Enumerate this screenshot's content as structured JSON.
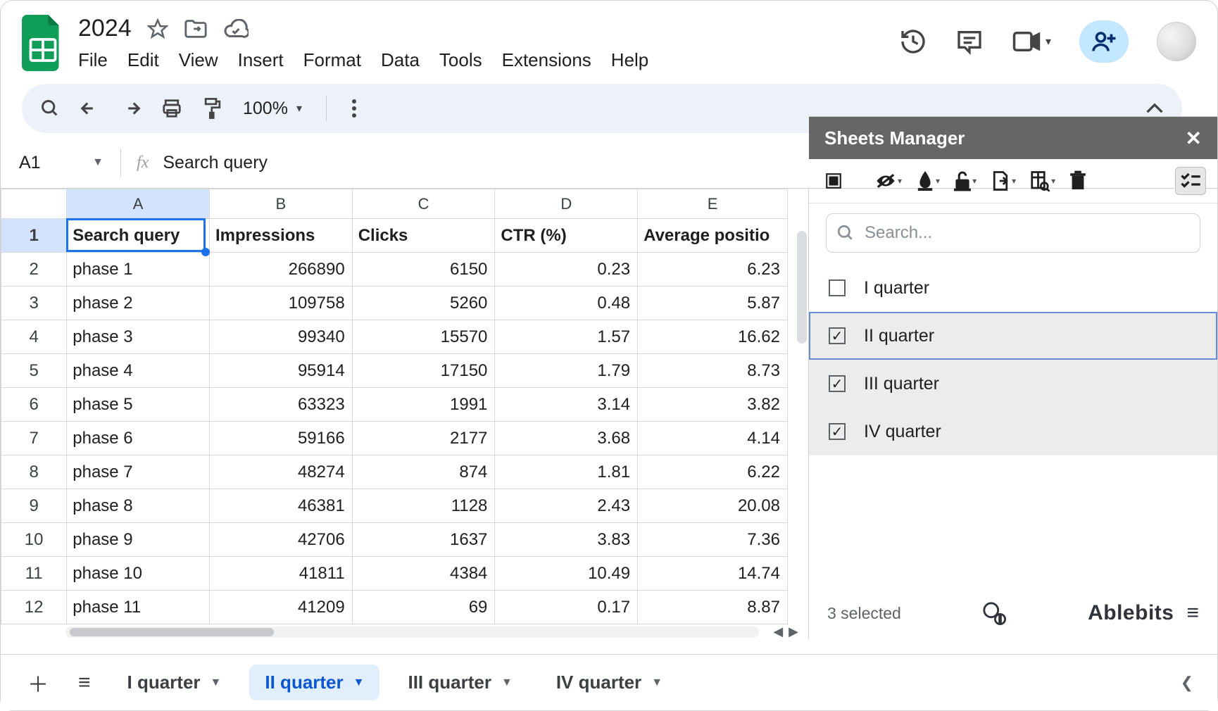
{
  "doc": {
    "title": "2024"
  },
  "menus": [
    "File",
    "Edit",
    "View",
    "Insert",
    "Format",
    "Data",
    "Tools",
    "Extensions",
    "Help"
  ],
  "toolbar": {
    "zoom": "100%"
  },
  "formula": {
    "cell": "A1",
    "fx": "fx",
    "value": "Search query"
  },
  "columns": [
    "A",
    "B",
    "C",
    "D",
    "E"
  ],
  "headers": [
    "Search query",
    "Impressions",
    "Clicks",
    "CTR (%)",
    "Average positio"
  ],
  "rows": [
    {
      "n": 1
    },
    {
      "n": 2,
      "q": "phase 1",
      "imp": "266890",
      "clk": "6150",
      "ctr": "0.23",
      "avg": "6.23"
    },
    {
      "n": 3,
      "q": "phase 2",
      "imp": "109758",
      "clk": "5260",
      "ctr": "0.48",
      "avg": "5.87"
    },
    {
      "n": 4,
      "q": "phase 3",
      "imp": "99340",
      "clk": "15570",
      "ctr": "1.57",
      "avg": "16.62"
    },
    {
      "n": 5,
      "q": "phase 4",
      "imp": "95914",
      "clk": "17150",
      "ctr": "1.79",
      "avg": "8.73"
    },
    {
      "n": 6,
      "q": "phase 5",
      "imp": "63323",
      "clk": "1991",
      "ctr": "3.14",
      "avg": "3.82"
    },
    {
      "n": 7,
      "q": "phase 6",
      "imp": "59166",
      "clk": "2177",
      "ctr": "3.68",
      "avg": "4.14"
    },
    {
      "n": 8,
      "q": "phase 7",
      "imp": "48274",
      "clk": "874",
      "ctr": "1.81",
      "avg": "6.22"
    },
    {
      "n": 9,
      "q": "phase 8",
      "imp": "46381",
      "clk": "1128",
      "ctr": "2.43",
      "avg": "20.08"
    },
    {
      "n": 10,
      "q": "phase 9",
      "imp": "42706",
      "clk": "1637",
      "ctr": "3.83",
      "avg": "7.36"
    },
    {
      "n": 11,
      "q": "phase 10",
      "imp": "41811",
      "clk": "4384",
      "ctr": "10.49",
      "avg": "14.74"
    },
    {
      "n": 12,
      "q": "phase 11",
      "imp": "41209",
      "clk": "69",
      "ctr": "0.17",
      "avg": "8.87"
    }
  ],
  "sidebar": {
    "title": "Sheets Manager",
    "search_placeholder": "Search...",
    "items": [
      {
        "label": "I quarter",
        "checked": false,
        "selected": false
      },
      {
        "label": "II quarter",
        "checked": true,
        "selected": true
      },
      {
        "label": "III quarter",
        "checked": true,
        "selected": true
      },
      {
        "label": "IV quarter",
        "checked": true,
        "selected": true
      }
    ],
    "status": "3 selected",
    "brand": "Ablebits"
  },
  "tabs": [
    {
      "label": "I quarter",
      "active": false
    },
    {
      "label": "II quarter",
      "active": true
    },
    {
      "label": "III quarter",
      "active": false
    },
    {
      "label": "IV quarter",
      "active": false
    }
  ]
}
